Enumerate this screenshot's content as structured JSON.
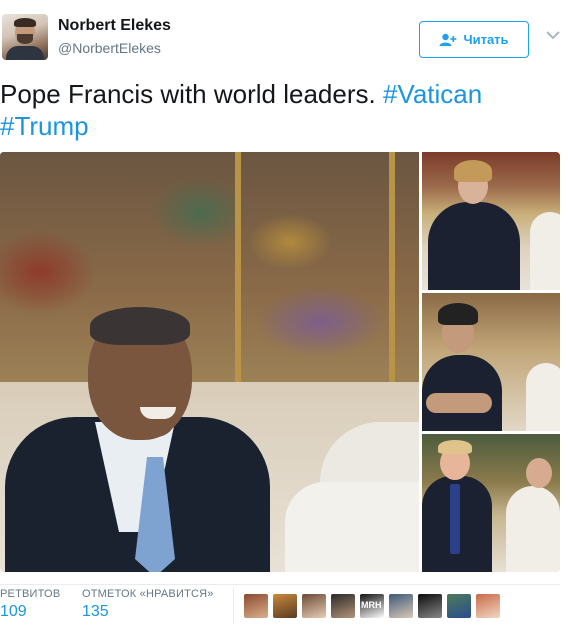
{
  "user": {
    "display_name": "Norbert Elekes",
    "username": "@NorbertElekes"
  },
  "follow_button": {
    "label": "Читать"
  },
  "tweet": {
    "text": "Pope Francis with world leaders. ",
    "hashtags": [
      "#Vatican",
      "#Trump"
    ]
  },
  "stats": {
    "retweets_label": "РЕТВИТОВ",
    "retweets_value": "109",
    "likes_label": "ОТМЕТОК «НРАВИТСЯ»",
    "likes_value": "135"
  },
  "likers": [
    {
      "colors": [
        "#8c4a30",
        "#d9b08c"
      ]
    },
    {
      "colors": [
        "#c98a3b",
        "#5a3a25"
      ]
    },
    {
      "colors": [
        "#6b4a38",
        "#e8cdb4"
      ]
    },
    {
      "colors": [
        "#2a2a2a",
        "#b49378"
      ]
    },
    {
      "colors": [
        "#111111",
        "#ffffff"
      ],
      "text": "MRH"
    },
    {
      "colors": [
        "#3d5a7a",
        "#d9c7b5"
      ]
    },
    {
      "colors": [
        "#0d0d0d",
        "#888888"
      ]
    },
    {
      "colors": [
        "#4d7a5a",
        "#2b4d8f"
      ]
    },
    {
      "colors": [
        "#c96b4a",
        "#f1d6c2"
      ]
    }
  ],
  "icons": {
    "follow": "add-user-icon",
    "caret": "chevron-down-icon"
  },
  "colors": {
    "accent": "#1da1f2",
    "hashtag": "#1b95e0",
    "secondary_text": "#657786"
  }
}
